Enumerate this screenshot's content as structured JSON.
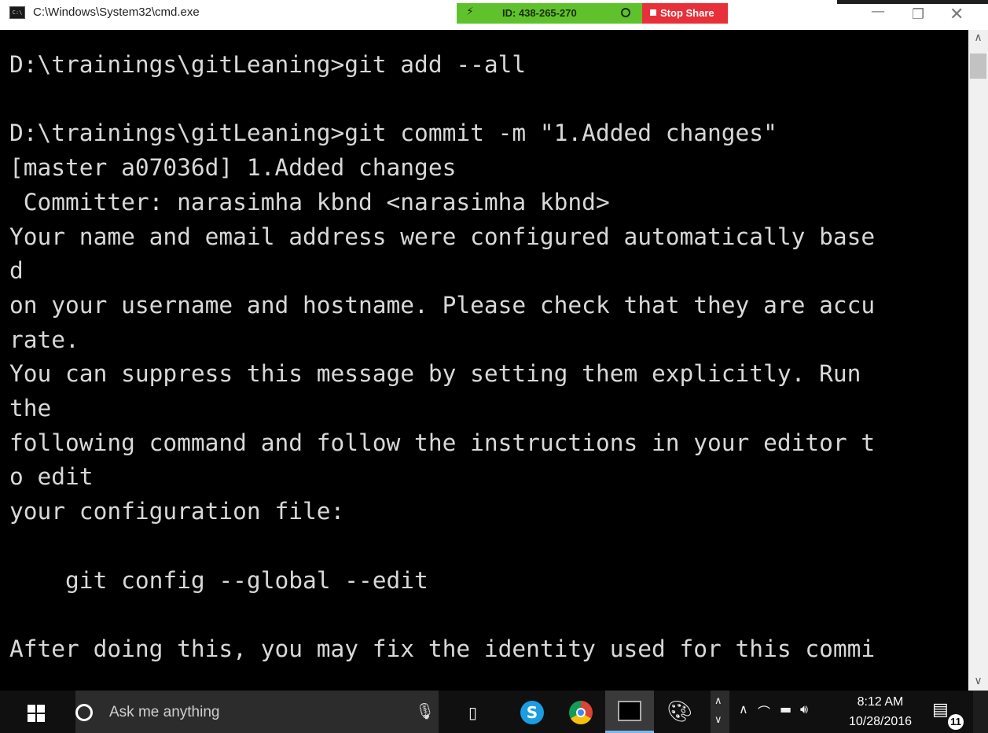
{
  "window": {
    "title": "C:\\Windows\\System32\\cmd.exe",
    "app_icon_label": "C:\\"
  },
  "share_bar": {
    "session_id": "ID: 438-265-270",
    "stop_label": "Stop Share",
    "colors": {
      "green": "#5fc22c",
      "red": "#e8303a"
    }
  },
  "console": {
    "lines": [
      "D:\\trainings\\gitLeaning>git add --all",
      "",
      "D:\\trainings\\gitLeaning>git commit -m \"1.Added changes\"",
      "[master a07036d] 1.Added changes",
      " Committer: narasimha kbnd <narasimha kbnd>",
      "Your name and email address were configured automatically base",
      "d",
      "on your username and hostname. Please check that they are accu",
      "rate.",
      "You can suppress this message by setting them explicitly. Run",
      "the",
      "following command and follow the instructions in your editor t",
      "o edit",
      "your configuration file:",
      "",
      "    git config --global --edit",
      "",
      "After doing this, you may fix the identity used for this commi"
    ],
    "colors": {
      "background": "#000000",
      "text": "#d8d8d8"
    }
  },
  "taskbar": {
    "search_placeholder": "Ask me anything",
    "time": "8:12 AM",
    "date": "10/28/2016",
    "notification_count": "11",
    "icons": [
      "windows-logo",
      "cortana",
      "microphone",
      "task-view",
      "skype",
      "chrome",
      "command-prompt",
      "paint",
      "overflow-chevron",
      "show-hidden-icons",
      "wifi",
      "battery",
      "volume",
      "action-center"
    ]
  }
}
